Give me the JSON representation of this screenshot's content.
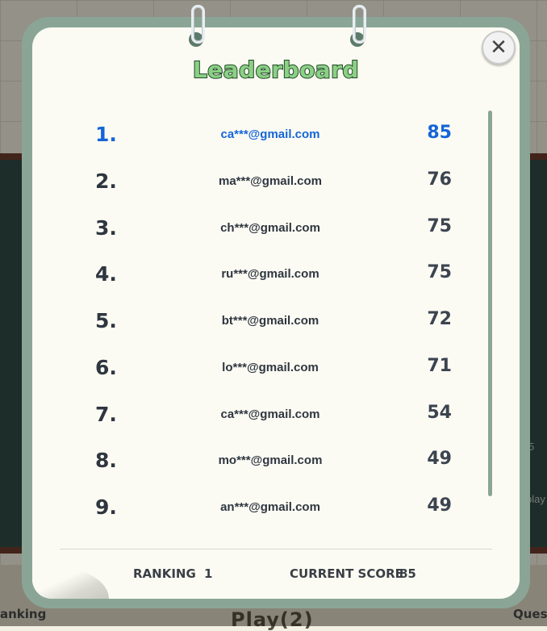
{
  "background": {
    "tabs": [
      "anking",
      "Ques"
    ],
    "play_label": "Play(2)",
    "side_texts": [
      "5",
      "play"
    ]
  },
  "modal": {
    "title": "Leaderboard",
    "close_icon": "close-icon",
    "entries": [
      {
        "rank": "1.",
        "email": "ca***@gmail.com",
        "score": "85"
      },
      {
        "rank": "2.",
        "email": "ma***@gmail.com",
        "score": "76"
      },
      {
        "rank": "3.",
        "email": "ch***@gmail.com",
        "score": "75"
      },
      {
        "rank": "4.",
        "email": "ru***@gmail.com",
        "score": "75"
      },
      {
        "rank": "5.",
        "email": "bt***@gmail.com",
        "score": "72"
      },
      {
        "rank": "6.",
        "email": "lo***@gmail.com",
        "score": "71"
      },
      {
        "rank": "7.",
        "email": "ca***@gmail.com",
        "score": "54"
      },
      {
        "rank": "8.",
        "email": "mo***@gmail.com",
        "score": "49"
      },
      {
        "rank": "9.",
        "email": "an***@gmail.com",
        "score": "49"
      }
    ],
    "footer": {
      "ranking_label": "RANKING",
      "ranking_value": "1",
      "score_label": "CURRENT SCORE",
      "score_value": "85"
    }
  },
  "colors": {
    "frame": "#8aa596",
    "paper": "#fcfbf3",
    "highlight": "#1565d8",
    "title_fill": "#8ccf86",
    "title_stroke": "#1f4b25"
  }
}
